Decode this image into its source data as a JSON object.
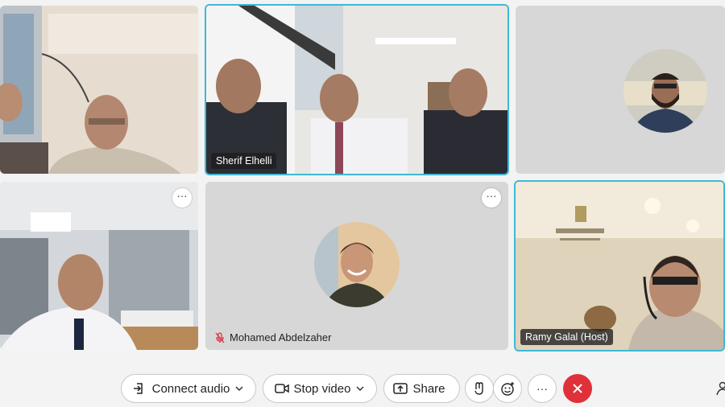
{
  "participants": [
    {
      "name": "",
      "tile": "top-left"
    },
    {
      "name": "Sherif Elhelli",
      "tile": "top-center",
      "active": true
    },
    {
      "name": "",
      "tile": "top-right",
      "avatar": true
    },
    {
      "name": "",
      "tile": "mid-left"
    },
    {
      "name": "Mohamed Abdelzaher",
      "tile": "mid-center",
      "avatar": true,
      "muted": true
    },
    {
      "name": "Ramy Galal (Host)",
      "tile": "mid-right",
      "active": true
    }
  ],
  "tile_menu_glyph": "···",
  "toolbar": {
    "connect_audio": "Connect audio",
    "stop_video": "Stop video",
    "share": "Share",
    "more_glyph": "···"
  },
  "icons": [
    "audio-icon",
    "chevron-down-icon",
    "camera-icon",
    "share-icon",
    "raise-hand-icon",
    "reaction-icon",
    "more-icon",
    "end-call-icon",
    "participants-icon",
    "muted-mic-icon",
    "tile-menu-icon"
  ],
  "colors": {
    "active_border": "#3fb8d6",
    "end_call": "#e0303a",
    "muted": "#d9303b"
  }
}
